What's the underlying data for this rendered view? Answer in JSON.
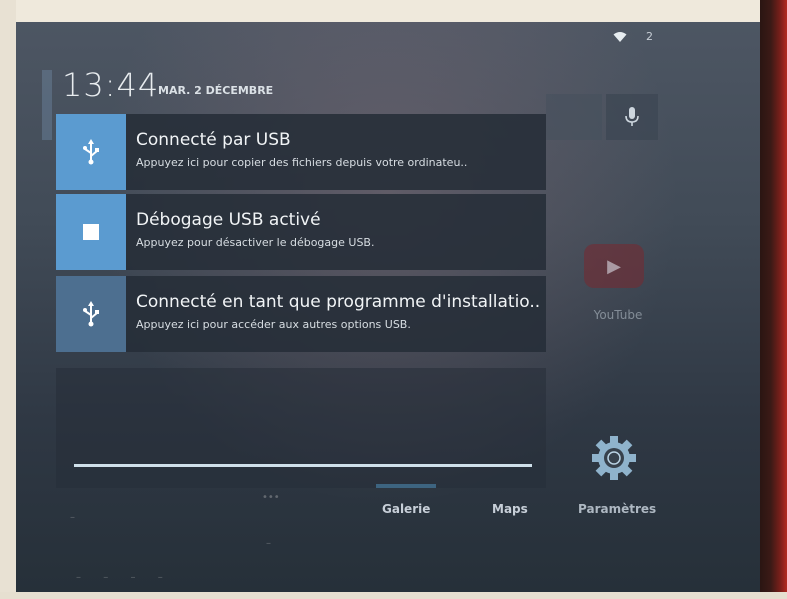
{
  "status_bar": {
    "wifi_icon": "wifi-icon",
    "battery_text": "2"
  },
  "header": {
    "time": "13:44",
    "date": "MAR. 2 DÉCEMBRE"
  },
  "notifications": [
    {
      "icon": "usb-icon",
      "title": "Connecté par USB",
      "text": "Appuyez ici pour copier des fichiers depuis votre ordinateu.."
    },
    {
      "icon": "debug-square-icon",
      "title": "Débogage USB activé",
      "text": "Appuyez pour désactiver le débogage USB."
    },
    {
      "icon": "usb-icon",
      "title": "Connecté en tant que programme d'installatio..",
      "text": "Appuyez ici pour accéder aux autres options USB."
    }
  ],
  "home": {
    "youtube_label": "YouTube",
    "dock": [
      "Galerie",
      "Maps",
      "Paramètres"
    ]
  },
  "colors": {
    "accent": "#5aa7d8",
    "notif_icon_bg": "#5b9bd0",
    "notif_bg": "#262e38"
  }
}
